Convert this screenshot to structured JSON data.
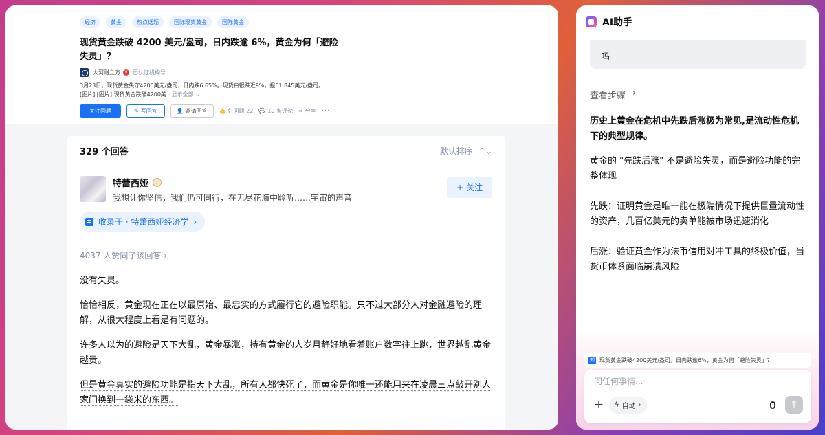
{
  "question": {
    "tags": [
      "经济",
      "黄金",
      "热点话题",
      "国际现货黄金",
      "国际黄金"
    ],
    "title": "现货黄金跌破 4200 美元/盎司，日内跌逾 6%，黄金为何「避险失灵」？",
    "source_name": "大河财立方",
    "source_note": "已认证机构号",
    "excerpt_line1": "3月23日，现货黄金失守4200美元/盎司，日内跌6.65%。现货白银跌近9%，报61.845美元/盎司。",
    "excerpt_line2": "[图片] [图片] 现货黄金跌破4200美...",
    "show_all": "显示全部",
    "actions": {
      "follow": "关注问题",
      "write": "写回答",
      "invite": "邀请回答",
      "good_question": "好问题 22",
      "comments": "10 条评论",
      "share": "分享",
      "more": "···"
    }
  },
  "answers": {
    "count_label": "329 个回答",
    "sort_label": "默认排序",
    "author_name": "特蕾西娅",
    "author_bio": "我想让你坚信，我们仍可同行，在无尽花海中聆听……宇宙的声音",
    "follow_label": "+ 关注",
    "collected_in": "收录于 · 特蕾西娅经济学",
    "votes_label": "4037 人赞同了该回答",
    "paragraphs": [
      "没有失灵。",
      "恰恰相反，黄金现在正在以最原始、最忠实的方式履行它的避险职能。只不过大部分人对金融避险的理解，从很大程度上看是有问题的。",
      "许多人以为的避险是天下大乱，黄金暴涨，持有黄金的人岁月静好地看着账户数字往上跳，世界越乱黄金越贵。",
      "但是黄金真实的避险功能是指天下大乱，所有人都快死了，而黄金是你唯一还能用来在凌晨三点敲开别人家门换到一袋米的东西。"
    ]
  },
  "ai": {
    "title": "AI助手",
    "user_msg_tail": "吗",
    "steps_label": "查看步骤",
    "conclusion": "历史上黄金在危机中先跌后涨极为常见,是流动性危机下的典型规律。",
    "p1": "黄金的 \"先跌后涨\" 不是避险失灵，而是避险功能的完整体现",
    "p2": "先跌：证明黄金是唯一能在极端情况下提供巨量流动性的资产，几百亿美元的卖单能被市场迅速消化",
    "p3": "后涨：验证黄金作为法币信用对冲工具的终极价值，当货币体系面临崩溃风险",
    "ref_text": "现货黄金跌破4200美元/盎司，日内跌逾6%，黄金为何「避险失灵」？",
    "ref_icon": "知",
    "input_placeholder": "问任何事情...",
    "mode_label": "自动",
    "plus": "+",
    "send": "↑"
  },
  "colors": {
    "accent": "#1772f6",
    "bg_gradient": [
      "#c43c8c",
      "#e0603a",
      "#4a3fc8"
    ]
  },
  "icons": [
    "ai-assistant-icon",
    "plus-icon",
    "mic-icon",
    "send-icon",
    "chevron-icon",
    "lightning-icon"
  ]
}
